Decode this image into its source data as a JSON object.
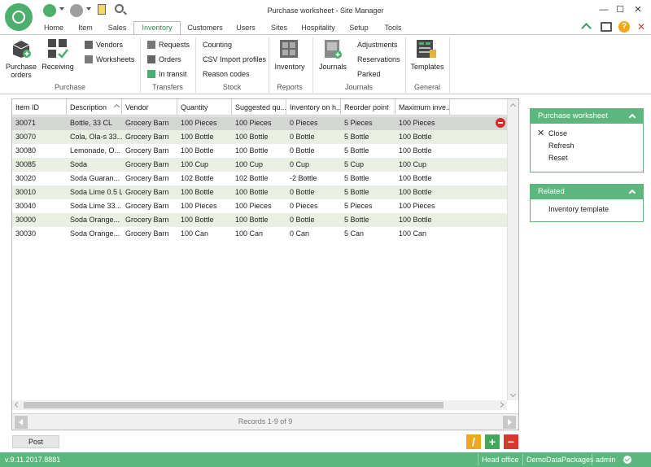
{
  "window": {
    "title": "Purchase worksheet - Site Manager",
    "minimize": "—",
    "maximize": "☐",
    "close": "✕"
  },
  "tabs": [
    "Home",
    "Item",
    "Sales",
    "Inventory",
    "Customers",
    "Users",
    "Sites",
    "Hospitality",
    "Setup",
    "Tools"
  ],
  "active_tab": "Inventory",
  "help_label": "?",
  "ribbon": {
    "purchase": {
      "purchase_orders": "Purchase orders",
      "receiving": "Receiving",
      "vendors": "Vendors",
      "worksheets": "Worksheets",
      "group": "Purchase"
    },
    "transfers": {
      "requests": "Requests",
      "orders": "Orders",
      "in_transit": "In transit",
      "group": "Transfers"
    },
    "stock": {
      "counting": "Counting",
      "csv_import": "CSV Import profiles",
      "reason_codes": "Reason codes",
      "group": "Stock"
    },
    "reports": {
      "inventory": "Inventory",
      "group": "Reports"
    },
    "journals": {
      "journals": "Journals",
      "adjustments": "Adjustments",
      "reservations": "Reservations",
      "parked": "Parked",
      "group": "Journals"
    },
    "general": {
      "templates": "Templates",
      "group": "General"
    }
  },
  "grid": {
    "columns": [
      "Item ID",
      "Description",
      "Vendor",
      "Quantity",
      "Suggested qu...",
      "Inventory on h...",
      "Reorder point",
      "Maximum inve..."
    ],
    "rows": [
      [
        "30071",
        "Bottle, 33 CL",
        "Grocery Barn",
        "100 Pieces",
        "100 Pieces",
        "0 Pieces",
        "5 Pieces",
        "100 Pieces"
      ],
      [
        "30070",
        "Cola, Ola-s 33...",
        "Grocery Barn",
        "100 Bottle",
        "100 Bottle",
        "0 Bottle",
        "5 Bottle",
        "100 Bottle"
      ],
      [
        "30080",
        "Lemonade, O...",
        "Grocery Barn",
        "100 Bottle",
        "100 Bottle",
        "0 Bottle",
        "5 Bottle",
        "100 Bottle"
      ],
      [
        "30085",
        "Soda",
        "Grocery Barn",
        "100 Cup",
        "100 Cup",
        "0 Cup",
        "5 Cup",
        "100 Cup"
      ],
      [
        "30020",
        "Soda Guaran...",
        "Grocery Barn",
        "102 Bottle",
        "102 Bottle",
        "-2 Bottle",
        "5 Bottle",
        "100 Bottle"
      ],
      [
        "30010",
        "Soda Lime 0.5 L",
        "Grocery Barn",
        "100 Bottle",
        "100 Bottle",
        "0 Bottle",
        "5 Bottle",
        "100 Bottle"
      ],
      [
        "30040",
        "Soda Lime 33...",
        "Grocery Barn",
        "100 Pieces",
        "100 Pieces",
        "0 Pieces",
        "5 Pieces",
        "100 Pieces"
      ],
      [
        "30000",
        "Soda Orange...",
        "Grocery Barn",
        "100 Bottle",
        "100 Bottle",
        "0 Bottle",
        "5 Bottle",
        "100 Bottle"
      ],
      [
        "30030",
        "Soda Orange...",
        "Grocery Barn",
        "100 Can",
        "100 Can",
        "0 Can",
        "5 Can",
        "100 Can"
      ]
    ],
    "selected_row": 0,
    "records": "Records 1-9 of 9"
  },
  "panels": {
    "worksheet": {
      "title": "Purchase worksheet",
      "items": [
        "Close",
        "Refresh",
        "Reset"
      ]
    },
    "related": {
      "title": "Related",
      "items": [
        "Inventory template"
      ]
    }
  },
  "footer": {
    "post": "Post",
    "edit": "/",
    "add": "+",
    "delete": "−"
  },
  "status": {
    "version": "v.9.11.2017.8881",
    "office": "Head office",
    "data": "DemoDataPackages",
    "user": "admin"
  },
  "colors": {
    "accent": "#5cb77e",
    "selected_row": "#d4d6d4",
    "alt_row": "#e9efe3",
    "edit": "#f0a81b",
    "add": "#43a85c",
    "delete": "#d43a2e"
  }
}
